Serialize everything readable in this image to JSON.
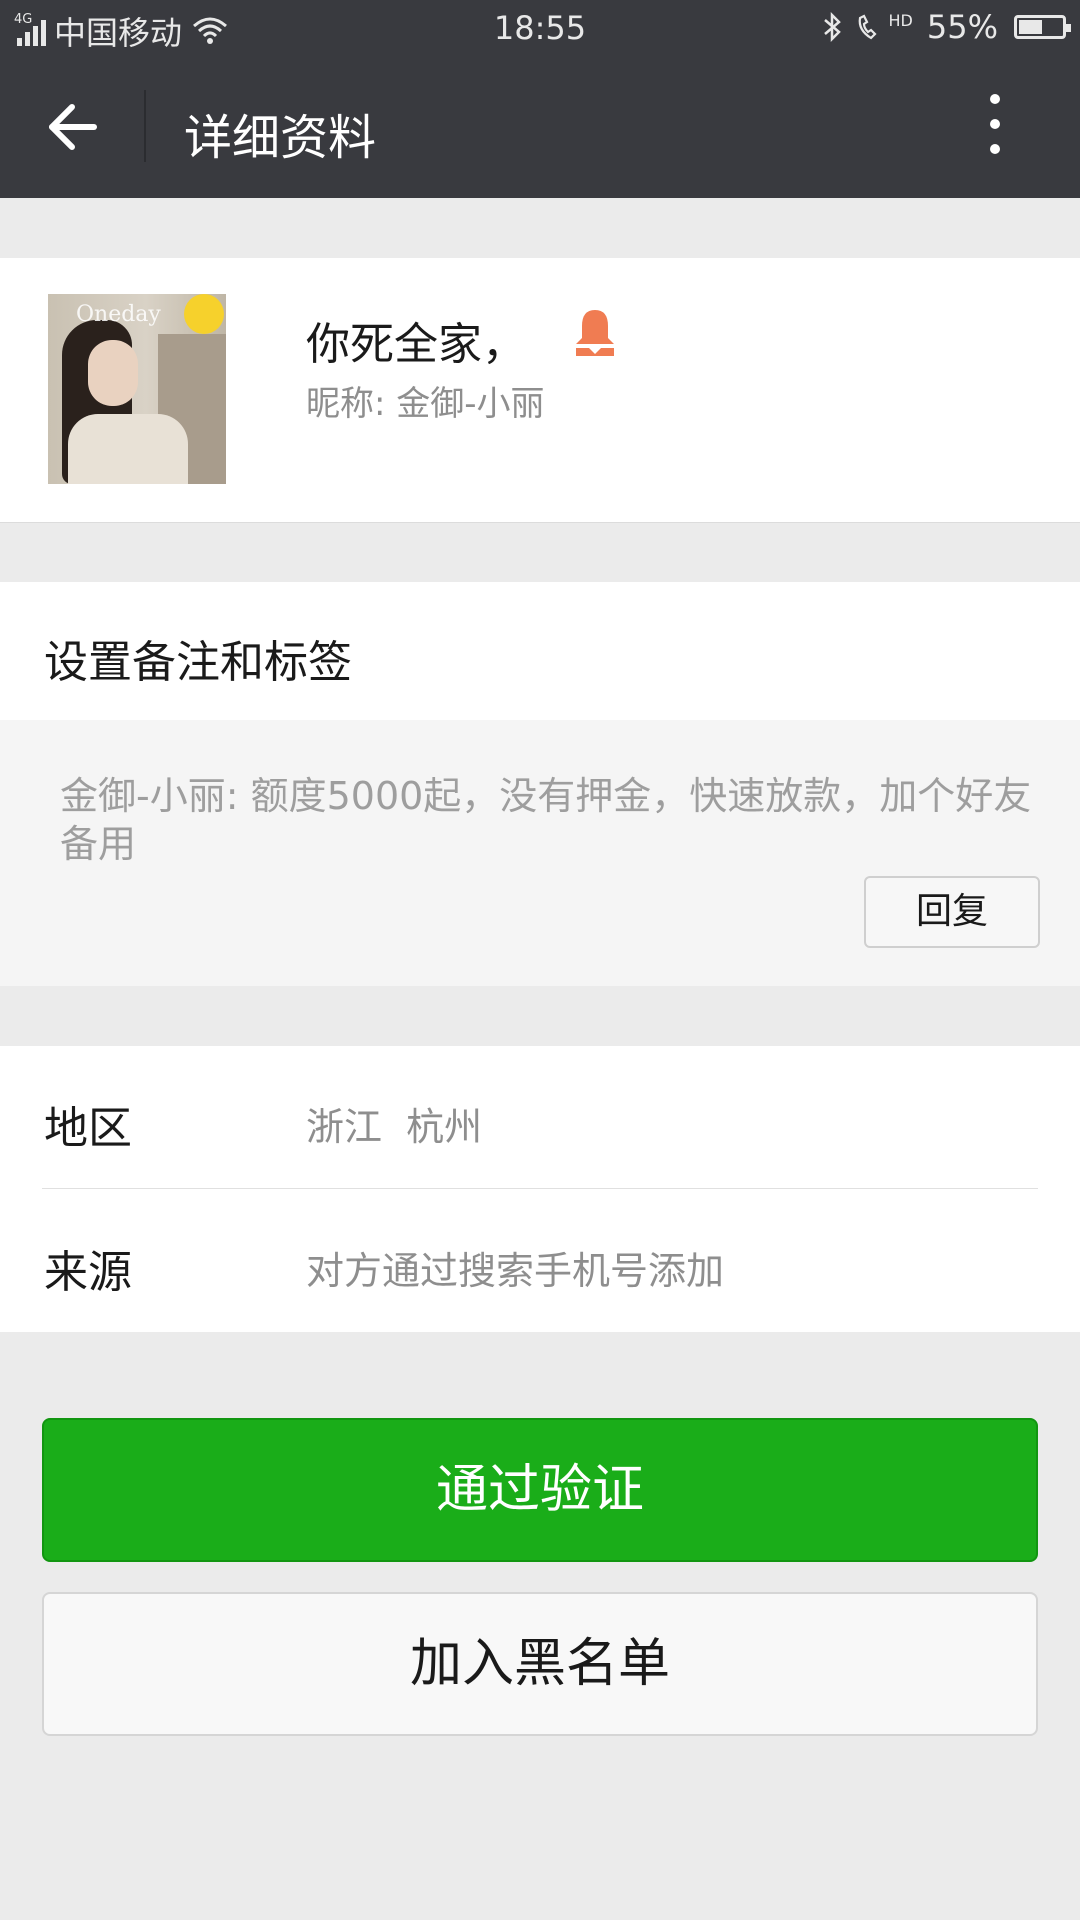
{
  "status_bar": {
    "network_type": "4G",
    "carrier": "中国移动",
    "time": "18:55",
    "hd_label": "HD",
    "battery_percent": "55%",
    "battery_level": 0.55,
    "icons": [
      "signal-icon",
      "wifi-icon",
      "bluetooth-icon",
      "hd-call-icon",
      "battery-icon"
    ]
  },
  "nav": {
    "title": "详细资料",
    "back_icon": "arrow-left-icon",
    "more_icon": "more-vertical-icon"
  },
  "profile": {
    "name": "你死全家，",
    "nickname": "昵称: 金御-小丽",
    "avatar_watermark": "Oneday",
    "gender_icon": "female-icon",
    "gender_color": "#f07c52"
  },
  "remark": {
    "title": "设置备注和标签",
    "message": "金御-小丽: 额度5000起，没有押金，快速放款，加个好友备用",
    "reply_label": "回复"
  },
  "info": {
    "rows": [
      {
        "label": "地区",
        "value": "浙江  杭州"
      },
      {
        "label": "来源",
        "value": "对方通过搜索手机号添加"
      }
    ]
  },
  "actions": {
    "primary_label": "通过验证",
    "secondary_label": "加入黑名单",
    "primary_color": "#1aad19"
  }
}
